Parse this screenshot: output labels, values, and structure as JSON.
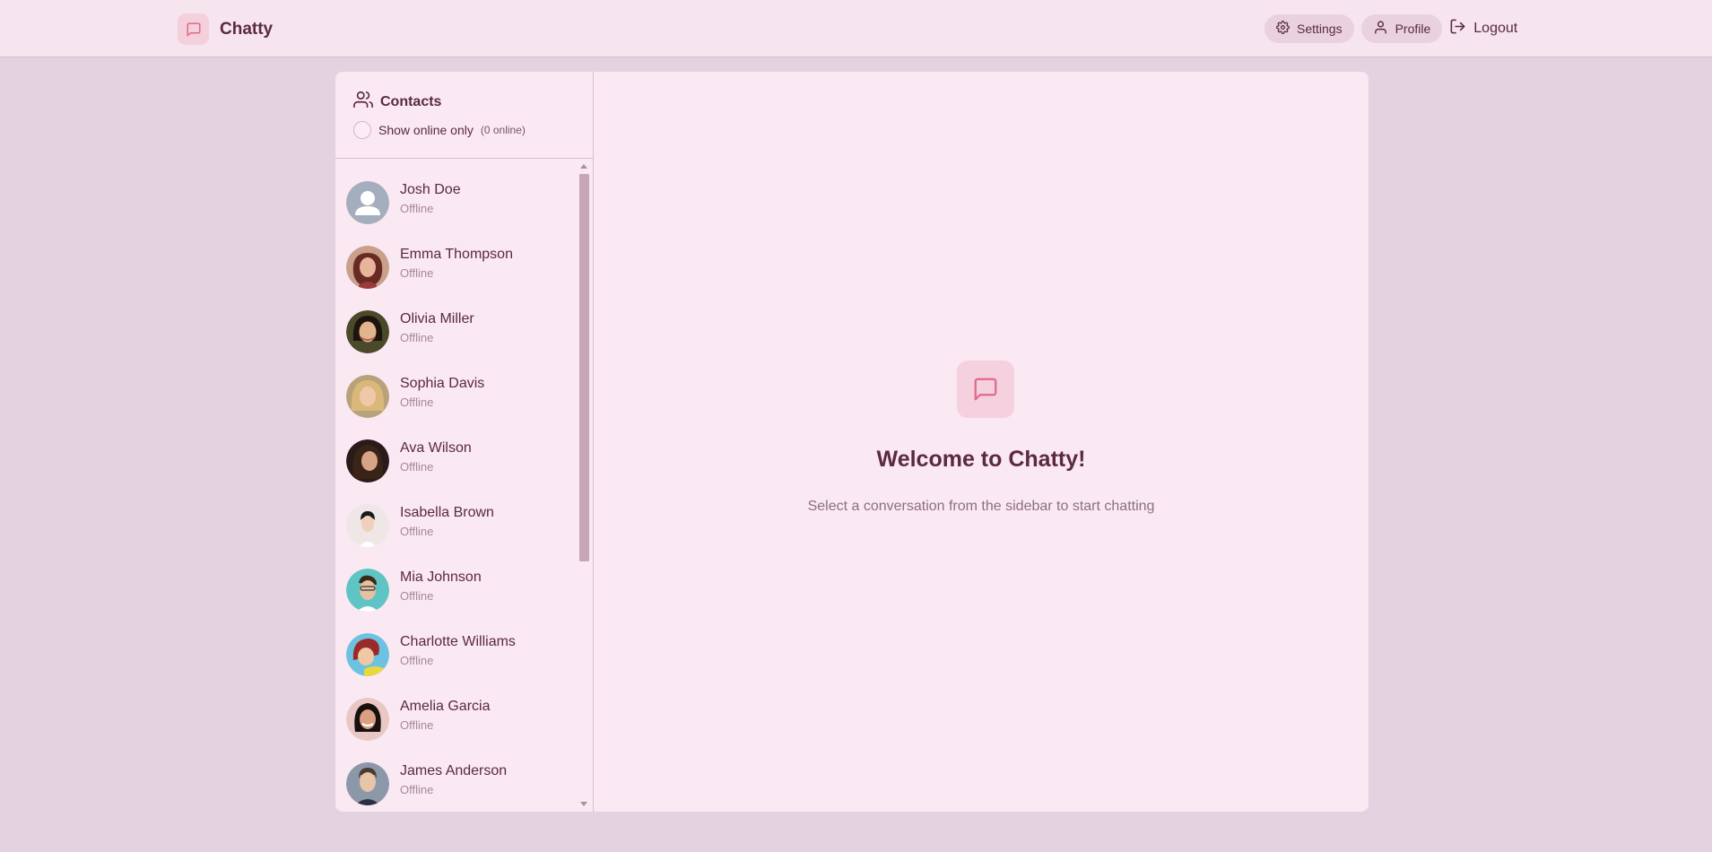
{
  "app": {
    "name": "Chatty",
    "accent_color": "#e06a8a"
  },
  "nav": {
    "settings_label": "Settings",
    "profile_label": "Profile",
    "logout_label": "Logout"
  },
  "sidebar": {
    "title": "Contacts",
    "online_toggle_label": "Show online only",
    "online_count": "(0 online)",
    "contacts": [
      {
        "name": "Josh Doe",
        "status": "Offline",
        "avatar": "default-avatar-icon"
      },
      {
        "name": "Emma Thompson",
        "status": "Offline",
        "avatar": "photo"
      },
      {
        "name": "Olivia Miller",
        "status": "Offline",
        "avatar": "photo"
      },
      {
        "name": "Sophia Davis",
        "status": "Offline",
        "avatar": "photo"
      },
      {
        "name": "Ava Wilson",
        "status": "Offline",
        "avatar": "photo"
      },
      {
        "name": "Isabella Brown",
        "status": "Offline",
        "avatar": "photo"
      },
      {
        "name": "Mia Johnson",
        "status": "Offline",
        "avatar": "photo"
      },
      {
        "name": "Charlotte Williams",
        "status": "Offline",
        "avatar": "photo"
      },
      {
        "name": "Amelia Garcia",
        "status": "Offline",
        "avatar": "photo"
      },
      {
        "name": "James Anderson",
        "status": "Offline",
        "avatar": "photo"
      }
    ]
  },
  "welcome": {
    "title": "Welcome to Chatty!",
    "subtitle": "Select a conversation from the sidebar to start chatting"
  }
}
